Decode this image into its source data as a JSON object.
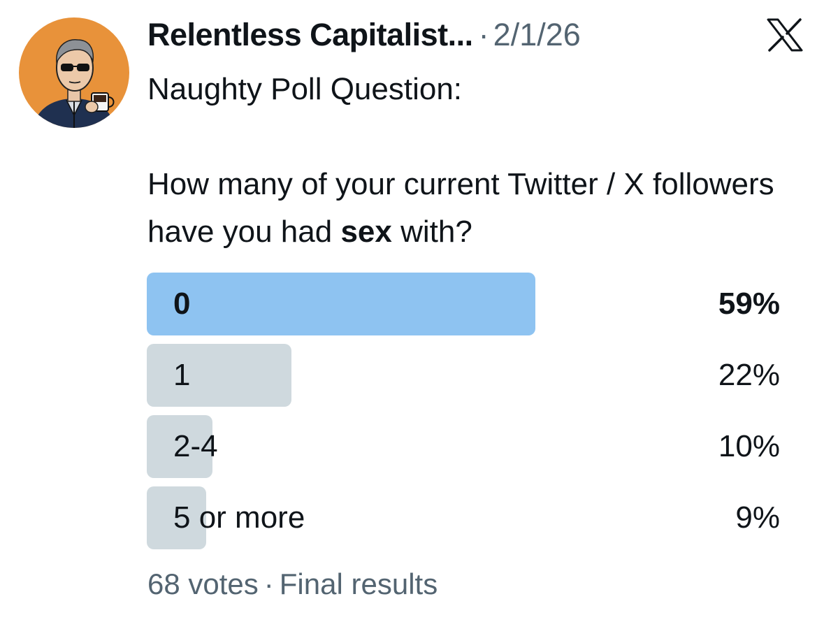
{
  "tweet": {
    "author_name": "Relentless Capitalist...",
    "separator": "·",
    "date": "2/1/26",
    "text_line1": "Naughty Poll Question:",
    "text_line2_part1": "How many of your current Twitter / X followers have you had ",
    "text_line2_bold": "sex",
    "text_line2_part2": " with?",
    "avatar_icon": "cartoon-man-sunglasses-coffee-avatar",
    "platform_icon": "x-logo-icon"
  },
  "poll": {
    "options": [
      {
        "label": "0",
        "percent_text": "59%",
        "percent": 59,
        "winner": true
      },
      {
        "label": "1",
        "percent_text": "22%",
        "percent": 22,
        "winner": false
      },
      {
        "label": "2-4",
        "percent_text": "10%",
        "percent": 10,
        "winner": false
      },
      {
        "label": "5 or more",
        "percent_text": "9%",
        "percent": 9,
        "winner": false
      }
    ],
    "votes": "68 votes",
    "footer_separator": "·",
    "status": "Final results"
  },
  "colors": {
    "winner_bar": "#8ec3f1",
    "other_bar": "#cfd9de",
    "secondary_text": "#536471",
    "avatar_bg": "#e8923a"
  }
}
